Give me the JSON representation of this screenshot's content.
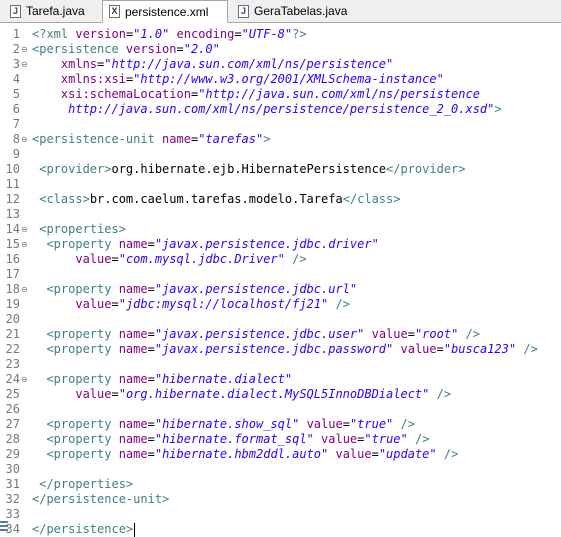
{
  "tabs": [
    {
      "label": "Tarefa.java",
      "icon": "java-file-icon",
      "icon_glyph": "J",
      "active": false
    },
    {
      "label": "persistence.xml",
      "icon": "xml-file-icon",
      "icon_glyph": "X",
      "active": true
    },
    {
      "label": "GeraTabelas.java",
      "icon": "java-file-icon",
      "icon_glyph": "J",
      "active": false
    }
  ],
  "close_glyph": "✕",
  "editor": {
    "lines": [
      {
        "n": "1",
        "fold": "",
        "tokens": [
          {
            "c": "t",
            "s": "<?xml "
          },
          {
            "c": "a",
            "s": "version"
          },
          {
            "c": "txt",
            "s": "="
          },
          {
            "c": "v",
            "s": "\"1.0\""
          },
          {
            "c": "txt",
            "s": " "
          },
          {
            "c": "a",
            "s": "encoding"
          },
          {
            "c": "txt",
            "s": "="
          },
          {
            "c": "v",
            "s": "\"UTF-8\""
          },
          {
            "c": "t",
            "s": "?>"
          }
        ]
      },
      {
        "n": "2",
        "fold": "⊖",
        "tokens": [
          {
            "c": "t",
            "s": "<persistence "
          },
          {
            "c": "a",
            "s": "version"
          },
          {
            "c": "txt",
            "s": "="
          },
          {
            "c": "v",
            "s": "\"2.0\""
          }
        ]
      },
      {
        "n": "3",
        "fold": "⊖",
        "tokens": [
          {
            "c": "txt",
            "s": "    "
          },
          {
            "c": "a",
            "s": "xmlns"
          },
          {
            "c": "txt",
            "s": "="
          },
          {
            "c": "v",
            "s": "\"http://java.sun.com/xml/ns/persistence\""
          }
        ]
      },
      {
        "n": "4",
        "fold": "",
        "tokens": [
          {
            "c": "txt",
            "s": "    "
          },
          {
            "c": "a",
            "s": "xmlns:xsi"
          },
          {
            "c": "txt",
            "s": "="
          },
          {
            "c": "v",
            "s": "\"http://www.w3.org/2001/XMLSchema-instance\""
          }
        ]
      },
      {
        "n": "5",
        "fold": "",
        "tokens": [
          {
            "c": "txt",
            "s": "    "
          },
          {
            "c": "a",
            "s": "xsi:schemaLocation"
          },
          {
            "c": "txt",
            "s": "="
          },
          {
            "c": "v",
            "s": "\"http://java.sun.com/xml/ns/persistence"
          }
        ]
      },
      {
        "n": "6",
        "fold": "",
        "tokens": [
          {
            "c": "v",
            "s": "     http://java.sun.com/xml/ns/persistence/persistence_2_0.xsd\""
          },
          {
            "c": "t",
            "s": ">"
          }
        ]
      },
      {
        "n": "7",
        "fold": "",
        "tokens": []
      },
      {
        "n": "8",
        "fold": "⊖",
        "tokens": [
          {
            "c": "t",
            "s": "<persistence-unit "
          },
          {
            "c": "a",
            "s": "name"
          },
          {
            "c": "txt",
            "s": "="
          },
          {
            "c": "v",
            "s": "\"tarefas\""
          },
          {
            "c": "t",
            "s": ">"
          }
        ]
      },
      {
        "n": "9",
        "fold": "",
        "tokens": []
      },
      {
        "n": "10",
        "fold": "",
        "tokens": [
          {
            "c": "txt",
            "s": " "
          },
          {
            "c": "t",
            "s": "<provider>"
          },
          {
            "c": "txt",
            "s": "org.hibernate.ejb.HibernatePersistence"
          },
          {
            "c": "t",
            "s": "</provider>"
          }
        ]
      },
      {
        "n": "11",
        "fold": "",
        "tokens": []
      },
      {
        "n": "12",
        "fold": "",
        "tokens": [
          {
            "c": "txt",
            "s": " "
          },
          {
            "c": "t",
            "s": "<class>"
          },
          {
            "c": "txt",
            "s": "br.com.caelum.tarefas.modelo.Tarefa"
          },
          {
            "c": "t",
            "s": "</class>"
          }
        ]
      },
      {
        "n": "13",
        "fold": "",
        "tokens": []
      },
      {
        "n": "14",
        "fold": "⊖",
        "tokens": [
          {
            "c": "txt",
            "s": " "
          },
          {
            "c": "t",
            "s": "<properties>"
          }
        ]
      },
      {
        "n": "15",
        "fold": "⊖",
        "tokens": [
          {
            "c": "txt",
            "s": "  "
          },
          {
            "c": "t",
            "s": "<property "
          },
          {
            "c": "a",
            "s": "name"
          },
          {
            "c": "txt",
            "s": "="
          },
          {
            "c": "v",
            "s": "\"javax.persistence.jdbc.driver\""
          }
        ]
      },
      {
        "n": "16",
        "fold": "",
        "tokens": [
          {
            "c": "txt",
            "s": "      "
          },
          {
            "c": "a",
            "s": "value"
          },
          {
            "c": "txt",
            "s": "="
          },
          {
            "c": "v",
            "s": "\"com.mysql.jdbc.Driver\""
          },
          {
            "c": "txt",
            "s": " "
          },
          {
            "c": "t",
            "s": "/>"
          }
        ]
      },
      {
        "n": "17",
        "fold": "",
        "tokens": []
      },
      {
        "n": "18",
        "fold": "⊖",
        "tokens": [
          {
            "c": "txt",
            "s": "  "
          },
          {
            "c": "t",
            "s": "<property "
          },
          {
            "c": "a",
            "s": "name"
          },
          {
            "c": "txt",
            "s": "="
          },
          {
            "c": "v",
            "s": "\"javax.persistence.jdbc.url\""
          }
        ]
      },
      {
        "n": "19",
        "fold": "",
        "tokens": [
          {
            "c": "txt",
            "s": "      "
          },
          {
            "c": "a",
            "s": "value"
          },
          {
            "c": "txt",
            "s": "="
          },
          {
            "c": "v",
            "s": "\"jdbc:mysql://localhost/fj21\""
          },
          {
            "c": "txt",
            "s": " "
          },
          {
            "c": "t",
            "s": "/>"
          }
        ]
      },
      {
        "n": "20",
        "fold": "",
        "tokens": []
      },
      {
        "n": "21",
        "fold": "",
        "tokens": [
          {
            "c": "txt",
            "s": "  "
          },
          {
            "c": "t",
            "s": "<property "
          },
          {
            "c": "a",
            "s": "name"
          },
          {
            "c": "txt",
            "s": "="
          },
          {
            "c": "v",
            "s": "\"javax.persistence.jdbc.user\""
          },
          {
            "c": "txt",
            "s": " "
          },
          {
            "c": "a",
            "s": "value"
          },
          {
            "c": "txt",
            "s": "="
          },
          {
            "c": "v",
            "s": "\"root\""
          },
          {
            "c": "txt",
            "s": " "
          },
          {
            "c": "t",
            "s": "/>"
          }
        ]
      },
      {
        "n": "22",
        "fold": "",
        "tokens": [
          {
            "c": "txt",
            "s": "  "
          },
          {
            "c": "t",
            "s": "<property "
          },
          {
            "c": "a",
            "s": "name"
          },
          {
            "c": "txt",
            "s": "="
          },
          {
            "c": "v",
            "s": "\"javax.persistence.jdbc.password\""
          },
          {
            "c": "txt",
            "s": " "
          },
          {
            "c": "a",
            "s": "value"
          },
          {
            "c": "txt",
            "s": "="
          },
          {
            "c": "v",
            "s": "\"busca123\""
          },
          {
            "c": "txt",
            "s": " "
          },
          {
            "c": "t",
            "s": "/>"
          }
        ]
      },
      {
        "n": "23",
        "fold": "",
        "tokens": []
      },
      {
        "n": "24",
        "fold": "⊖",
        "tokens": [
          {
            "c": "txt",
            "s": "  "
          },
          {
            "c": "t",
            "s": "<property "
          },
          {
            "c": "a",
            "s": "name"
          },
          {
            "c": "txt",
            "s": "="
          },
          {
            "c": "v",
            "s": "\"hibernate.dialect\""
          }
        ]
      },
      {
        "n": "25",
        "fold": "",
        "tokens": [
          {
            "c": "txt",
            "s": "      "
          },
          {
            "c": "a",
            "s": "value"
          },
          {
            "c": "txt",
            "s": "="
          },
          {
            "c": "v",
            "s": "\"org.hibernate.dialect.MySQL5InnoDBDialect\""
          },
          {
            "c": "txt",
            "s": " "
          },
          {
            "c": "t",
            "s": "/>"
          }
        ]
      },
      {
        "n": "26",
        "fold": "",
        "tokens": []
      },
      {
        "n": "27",
        "fold": "",
        "tokens": [
          {
            "c": "txt",
            "s": "  "
          },
          {
            "c": "t",
            "s": "<property "
          },
          {
            "c": "a",
            "s": "name"
          },
          {
            "c": "txt",
            "s": "="
          },
          {
            "c": "v",
            "s": "\"hibernate.show_sql\""
          },
          {
            "c": "txt",
            "s": " "
          },
          {
            "c": "a",
            "s": "value"
          },
          {
            "c": "txt",
            "s": "="
          },
          {
            "c": "v",
            "s": "\"true\""
          },
          {
            "c": "txt",
            "s": " "
          },
          {
            "c": "t",
            "s": "/>"
          }
        ]
      },
      {
        "n": "28",
        "fold": "",
        "tokens": [
          {
            "c": "txt",
            "s": "  "
          },
          {
            "c": "t",
            "s": "<property "
          },
          {
            "c": "a",
            "s": "name"
          },
          {
            "c": "txt",
            "s": "="
          },
          {
            "c": "v",
            "s": "\"hibernate.format_sql\""
          },
          {
            "c": "txt",
            "s": " "
          },
          {
            "c": "a",
            "s": "value"
          },
          {
            "c": "txt",
            "s": "="
          },
          {
            "c": "v",
            "s": "\"true\""
          },
          {
            "c": "txt",
            "s": " "
          },
          {
            "c": "t",
            "s": "/>"
          }
        ]
      },
      {
        "n": "29",
        "fold": "",
        "tokens": [
          {
            "c": "txt",
            "s": "  "
          },
          {
            "c": "t",
            "s": "<property "
          },
          {
            "c": "a",
            "s": "name"
          },
          {
            "c": "txt",
            "s": "="
          },
          {
            "c": "v",
            "s": "\"hibernate.hbm2ddl.auto\""
          },
          {
            "c": "txt",
            "s": " "
          },
          {
            "c": "a",
            "s": "value"
          },
          {
            "c": "txt",
            "s": "="
          },
          {
            "c": "v",
            "s": "\"update\""
          },
          {
            "c": "txt",
            "s": " "
          },
          {
            "c": "t",
            "s": "/>"
          }
        ]
      },
      {
        "n": "30",
        "fold": "",
        "tokens": []
      },
      {
        "n": "31",
        "fold": "",
        "tokens": [
          {
            "c": "txt",
            "s": " "
          },
          {
            "c": "t",
            "s": "</properties>"
          }
        ]
      },
      {
        "n": "32",
        "fold": "",
        "tokens": [
          {
            "c": "t",
            "s": "</persistence-unit>"
          }
        ]
      },
      {
        "n": "33",
        "fold": "",
        "tokens": []
      },
      {
        "n": "34",
        "fold": "",
        "tokens": [
          {
            "c": "t",
            "s": "</persistence>"
          }
        ]
      }
    ]
  }
}
